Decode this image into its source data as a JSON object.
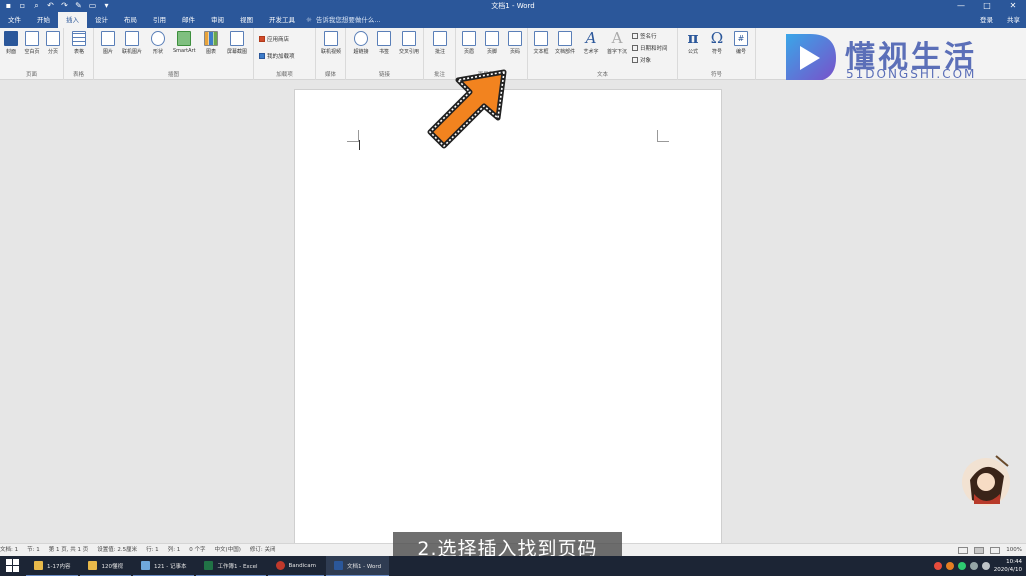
{
  "titlebar": {
    "title": "文档1 - Word",
    "qat": [
      "save-icon",
      "new-doc-icon",
      "print-preview-icon",
      "undo-icon",
      "redo-icon",
      "edit-icon",
      "open-icon",
      "customize-icon"
    ],
    "controls": [
      "—",
      "□",
      "✕"
    ]
  },
  "tabs": [
    "文件",
    "开始",
    "插入",
    "设计",
    "布局",
    "引用",
    "邮件",
    "审阅",
    "视图",
    "开发工具"
  ],
  "active_tab": "插入",
  "tellme": {
    "icon": "lightbulb-icon",
    "placeholder": "告诉我您想要做什么..."
  },
  "user": {
    "signin": "登录",
    "share": "共享"
  },
  "ribbon": {
    "groups": [
      {
        "label": "页面",
        "buttons": [
          "封面",
          "空白页",
          "分页"
        ]
      },
      {
        "label": "表格",
        "buttons": [
          "表格"
        ]
      },
      {
        "label": "插图",
        "buttons": [
          "图片",
          "联机图片",
          "形状",
          "SmartArt",
          "图表",
          "屏幕截图"
        ]
      },
      {
        "label": "加载项",
        "buttons": [
          "应用商店",
          "我的加载项"
        ]
      },
      {
        "label": "媒体",
        "buttons": [
          "联机视频"
        ]
      },
      {
        "label": "链接",
        "buttons": [
          "超链接",
          "书签",
          "交叉引用"
        ]
      },
      {
        "label": "批注",
        "buttons": [
          "批注"
        ]
      },
      {
        "label": "页眉和页脚",
        "buttons": [
          "页眉",
          "页脚",
          "页码"
        ]
      },
      {
        "label": "文本",
        "buttons": [
          "文本框",
          "文档部件",
          "艺术字",
          "首字下沉"
        ],
        "small": [
          "签名行",
          "日期和时间",
          "对象"
        ]
      },
      {
        "label": "符号",
        "buttons": [
          "公式",
          "符号",
          "编号"
        ]
      }
    ]
  },
  "logo": {
    "text": "懂视生活",
    "sub": "51DONGSHI.COM"
  },
  "statusbar": {
    "items": [
      "文档: 1",
      "节: 1",
      "第 1 页, 共 1 页",
      "设置值: 2.5厘米",
      "行: 1",
      "列: 1",
      "0 个字",
      "中文(中国)",
      "修订: 关闭"
    ],
    "zoom": "100%"
  },
  "caption": "2.选择插入找到页码",
  "taskbar": {
    "items": [
      {
        "label": "1-17内容",
        "color": "#e8b94a"
      },
      {
        "label": "120懂视",
        "color": "#e8b94a"
      },
      {
        "label": "121 - 记事本",
        "color": "#6fa8dc"
      },
      {
        "label": "工作簿1 - Excel",
        "color": "#217346"
      },
      {
        "label": "Bandicam",
        "color": "#c0392b"
      },
      {
        "label": "文档1 - Word",
        "color": "#2b579a"
      }
    ],
    "time": "10:44",
    "date": "2020/4/10"
  }
}
